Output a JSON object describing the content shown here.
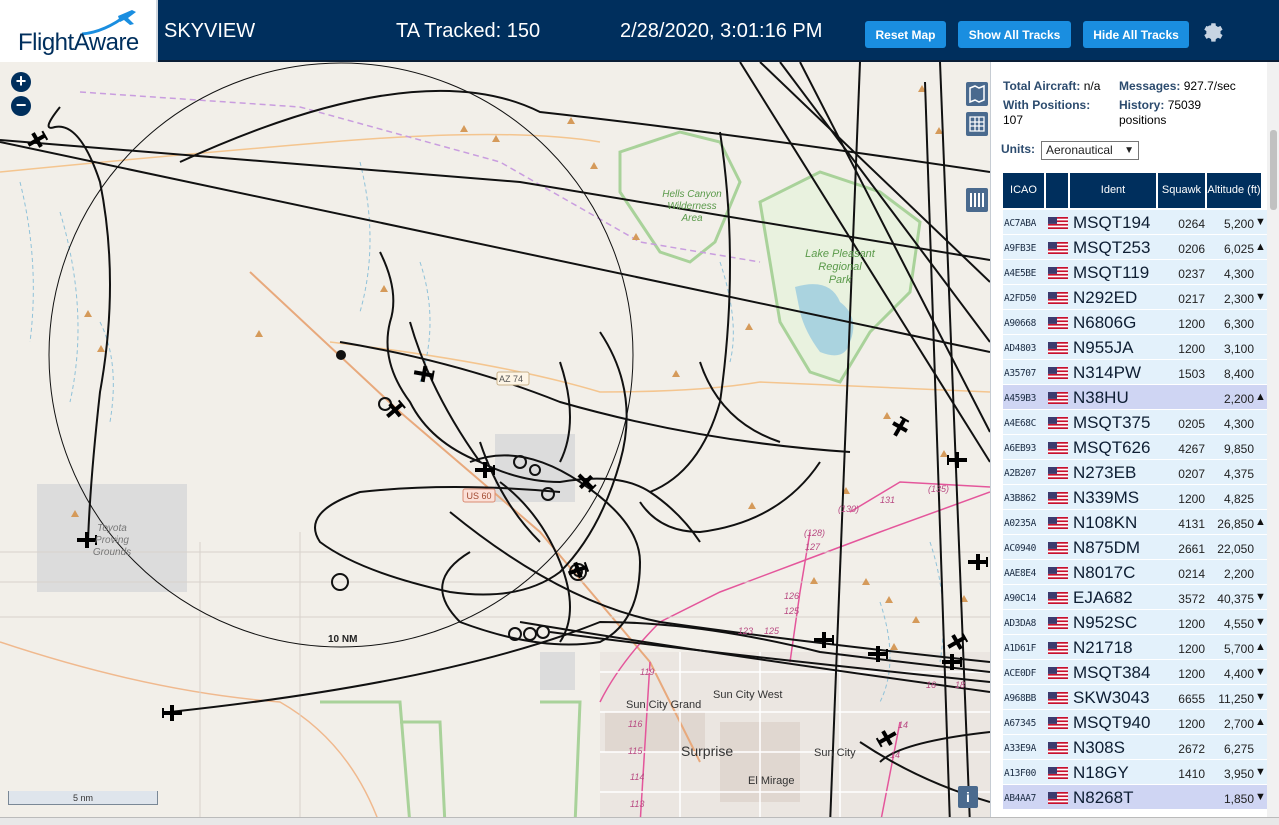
{
  "header": {
    "logo_text": "FlightAware",
    "site_name": "SKYVIEW",
    "tracked": "TA Tracked: 150",
    "datetime": "2/28/2020, 3:01:16 PM",
    "buttons": {
      "reset": "Reset Map",
      "show_all": "Show All Tracks",
      "hide_all": "Hide All Tracks"
    },
    "colors": {
      "bar": "#002f5d",
      "button": "#1a8ee0"
    }
  },
  "map": {
    "zoom_in": "+",
    "zoom_out": "−",
    "range_ring_label": "10 NM",
    "scale_label": "5 nm",
    "info_icon": "i",
    "labels": {
      "hells_canyon": "Hells Canyon Wilderness Area",
      "lake_pleasant": "Lake Pleasant Regional Park",
      "toyota": "Toyota Proving Grounds",
      "sun_city_grand": "Sun City Grand",
      "sun_city_west": "Sun City West",
      "sun_city": "Sun City",
      "surprise": "Surprise",
      "el_mirage": "El Mirage",
      "az74": "AZ 74",
      "us60": "US 60"
    },
    "road_numbers": [
      "(128)",
      "127",
      "126",
      "125",
      "(130)",
      "131",
      "(135)",
      "113",
      "114",
      "115",
      "116",
      "119",
      "14",
      "14",
      "16",
      "18",
      "17"
    ]
  },
  "panel": {
    "stats": {
      "total_label": "Total Aircraft:",
      "total_value": "n/a",
      "messages_label": "Messages:",
      "messages_value": "927.7/sec",
      "positions_label": "With Positions:",
      "positions_value": "107",
      "history_label": "History:",
      "history_value": "75039 positions"
    },
    "units_label": "Units:",
    "units_value": "Aeronautical",
    "columns": {
      "icao": "ICAO",
      "ident": "Ident",
      "squawk": "Squawk",
      "altitude": "Altitude (ft)"
    },
    "rows": [
      {
        "icao": "AC7ABA",
        "ident": "MSQT194",
        "squawk": "0264",
        "alt": "5,200",
        "trend": "▼"
      },
      {
        "icao": "A9FB3E",
        "ident": "MSQT253",
        "squawk": "0206",
        "alt": "6,025",
        "trend": "▲"
      },
      {
        "icao": "A4E5BE",
        "ident": "MSQT119",
        "squawk": "0237",
        "alt": "4,300",
        "trend": ""
      },
      {
        "icao": "A2FD50",
        "ident": "N292ED",
        "squawk": "0217",
        "alt": "2,300",
        "trend": "▼"
      },
      {
        "icao": "A90668",
        "ident": "N6806G",
        "squawk": "1200",
        "alt": "6,300",
        "trend": ""
      },
      {
        "icao": "AD4803",
        "ident": "N955JA",
        "squawk": "1200",
        "alt": "3,100",
        "trend": ""
      },
      {
        "icao": "A35707",
        "ident": "N314PW",
        "squawk": "1503",
        "alt": "8,400",
        "trend": ""
      },
      {
        "icao": "A459B3",
        "ident": "N38HU",
        "squawk": "",
        "alt": "2,200",
        "trend": "▲",
        "selected": true
      },
      {
        "icao": "A4E68C",
        "ident": "MSQT375",
        "squawk": "0205",
        "alt": "4,300",
        "trend": ""
      },
      {
        "icao": "A6EB93",
        "ident": "MSQT626",
        "squawk": "4267",
        "alt": "9,850",
        "trend": ""
      },
      {
        "icao": "A2B207",
        "ident": "N273EB",
        "squawk": "0207",
        "alt": "4,375",
        "trend": ""
      },
      {
        "icao": "A3B862",
        "ident": "N339MS",
        "squawk": "1200",
        "alt": "4,825",
        "trend": ""
      },
      {
        "icao": "A0235A",
        "ident": "N108KN",
        "squawk": "4131",
        "alt": "26,850",
        "trend": "▲"
      },
      {
        "icao": "AC0940",
        "ident": "N875DM",
        "squawk": "2661",
        "alt": "22,050",
        "trend": ""
      },
      {
        "icao": "AAE8E4",
        "ident": "N8017C",
        "squawk": "0214",
        "alt": "2,200",
        "trend": ""
      },
      {
        "icao": "A90C14",
        "ident": "EJA682",
        "squawk": "3572",
        "alt": "40,375",
        "trend": "▼"
      },
      {
        "icao": "AD3DA8",
        "ident": "N952SC",
        "squawk": "1200",
        "alt": "4,550",
        "trend": "▼"
      },
      {
        "icao": "A1D61F",
        "ident": "N21718",
        "squawk": "1200",
        "alt": "5,700",
        "trend": "▲"
      },
      {
        "icao": "ACE0DF",
        "ident": "MSQT384",
        "squawk": "1200",
        "alt": "4,400",
        "trend": "▼"
      },
      {
        "icao": "A968BB",
        "ident": "SKW3043",
        "squawk": "6655",
        "alt": "11,250",
        "trend": "▼"
      },
      {
        "icao": "A67345",
        "ident": "MSQT940",
        "squawk": "1200",
        "alt": "2,700",
        "trend": "▲"
      },
      {
        "icao": "A33E9A",
        "ident": "N308S",
        "squawk": "2672",
        "alt": "6,275",
        "trend": ""
      },
      {
        "icao": "A13F00",
        "ident": "N18GY",
        "squawk": "1410",
        "alt": "3,950",
        "trend": "▼"
      },
      {
        "icao": "AB4AA7",
        "ident": "N8268T",
        "squawk": "",
        "alt": "1,850",
        "trend": "▼",
        "selected": true
      }
    ]
  }
}
